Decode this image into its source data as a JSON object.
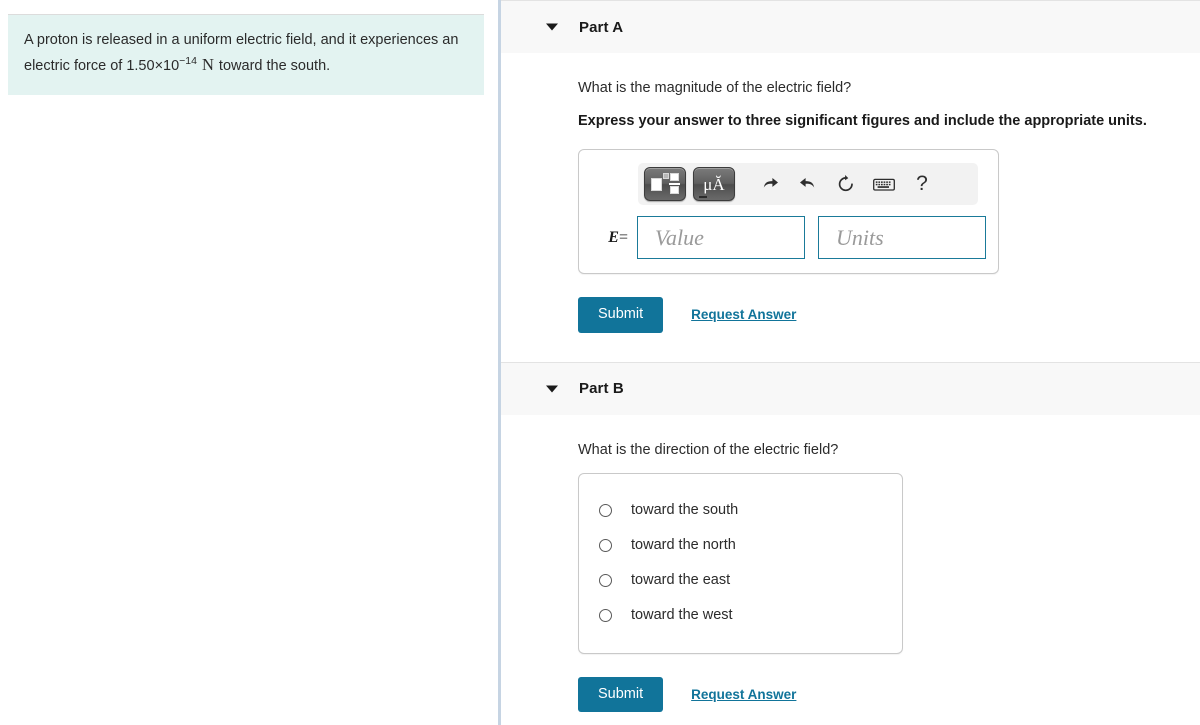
{
  "problem": {
    "text_before": "A proton is released in a uniform electric field, and it experiences an electric force of ",
    "value": "1.50×10",
    "exponent": "−14",
    "unit": "N",
    "text_after": " toward the south."
  },
  "parts": [
    {
      "header": "Part A",
      "question": "What is the magnitude of the electric field?",
      "instruction": "Express your answer to three significant figures and include the appropriate units.",
      "answer": {
        "variable_label": "E",
        "equals": "=",
        "value_placeholder": "Value",
        "units_placeholder": "Units",
        "value_current": "",
        "units_current": "",
        "toolbar": [
          {
            "name": "math-template-button",
            "label": ""
          },
          {
            "name": "units-button",
            "label": "μĂ"
          },
          {
            "name": "undo-icon",
            "label": ""
          },
          {
            "name": "redo-icon",
            "label": ""
          },
          {
            "name": "reset-icon",
            "label": ""
          },
          {
            "name": "keyboard-icon",
            "label": ""
          },
          {
            "name": "help-icon",
            "label": "?"
          }
        ]
      },
      "submit_label": "Submit",
      "request_answer_label": "Request Answer"
    },
    {
      "header": "Part B",
      "question": "What is the direction of the electric field?",
      "choices": [
        "toward the south",
        "toward the north",
        "toward the east",
        "toward the west"
      ],
      "submit_label": "Submit",
      "request_answer_label": "Request Answer"
    }
  ],
  "colors": {
    "problem_background": "#e3f3f1",
    "divider": "#c6d4e3",
    "accent": "#11749a",
    "field_border": "#1a7a99",
    "part_header_background": "#f8f8f8"
  }
}
